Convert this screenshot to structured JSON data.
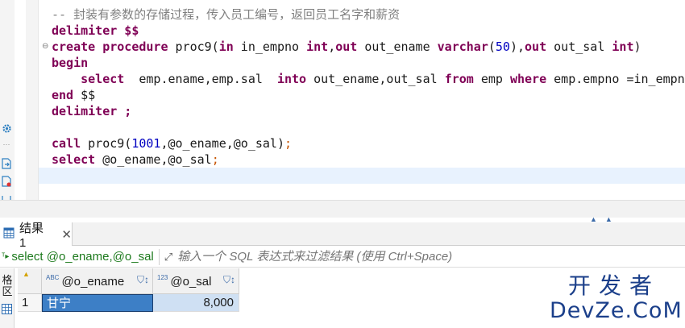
{
  "editor": {
    "lines": {
      "comment": "-- 封装有参数的存储过程，传入员工编号，返回员工名字和薪资",
      "l1_kw1": "delimiter",
      "l1_rest": " $$",
      "l2_kw_create": "create",
      "l2_kw_procedure": " procedure",
      "l2_name": " proc9(",
      "l2_kw_in": "in",
      "l2_p1": " in_empno ",
      "l2_kw_int1": "int",
      "l2_comma1": ",",
      "l2_kw_out1": "out",
      "l2_p2": " out_ename ",
      "l2_kw_varchar": "varchar",
      "l2_paren_open": "(",
      "l2_num50": "50",
      "l2_paren_close": "),",
      "l2_kw_out2": "out",
      "l2_p3": " out_sal ",
      "l2_kw_int2": "int",
      "l2_end": ")",
      "l3_kw_begin": "begin",
      "l4_indent": "    ",
      "l4_kw_select": "select",
      "l4_cols": "  emp.ename,emp.sal  ",
      "l4_kw_into": "into",
      "l4_vars": " out_ename,out_sal ",
      "l4_kw_from": "from",
      "l4_tbl": " emp ",
      "l4_kw_where": "where",
      "l4_cond": " emp.empno =in_empno",
      "l5_kw_end": "end",
      "l5_rest": " $$",
      "l6_kw_delimiter": "delimiter",
      "l6_rest": " ;",
      "l8_kw_call": "call",
      "l8_a": " proc9(",
      "l8_num": "1001",
      "l8_b": ",@o_ename,@o_sal)",
      "l8_semi": ";",
      "l9_kw_select": "select",
      "l9_a": " @o_ename,@o_sal",
      "l9_semi": ";"
    }
  },
  "results_tab": {
    "label": "结果 1",
    "close_glyph": "✕"
  },
  "filter": {
    "query_text": "select @o_ename,@o_sal",
    "placeholder": "输入一个 SQL 表达式来过滤结果 (使用 Ctrl+Space)"
  },
  "grid": {
    "side_label": "格\n区",
    "columns": [
      {
        "type_badge": "ABC",
        "name": "@o_ename"
      },
      {
        "type_badge": "123",
        "name": "@o_sal"
      }
    ],
    "rows": [
      {
        "row_num": "1",
        "o_ename": "甘宁",
        "o_sal": "8,000"
      }
    ]
  },
  "watermark": {
    "cn": "开发者",
    "en": "DevZe.CoM"
  },
  "colors": {
    "keyword": "#7f0055",
    "number": "#0000c0",
    "comment": "#808080",
    "selected_cell": "#3d7fc6",
    "watermark": "#1b3f8a"
  }
}
